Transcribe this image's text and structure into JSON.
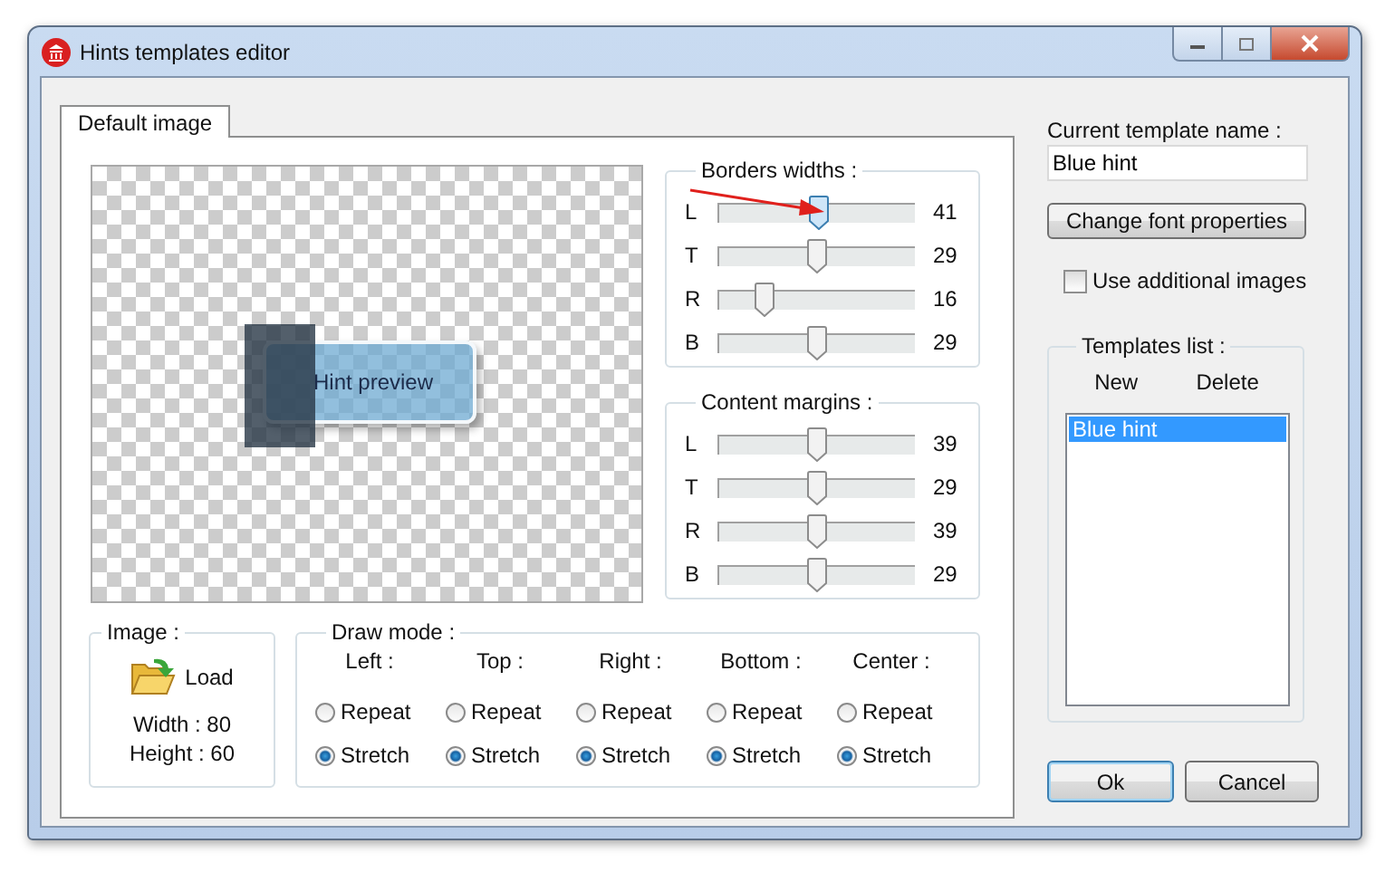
{
  "window": {
    "title": "Hints templates editor"
  },
  "tabs": [
    {
      "label": "Default image",
      "selected": true
    }
  ],
  "preview": {
    "text": "Hint preview"
  },
  "borders_widths": {
    "title": "Borders widths :",
    "sliders": [
      {
        "label": "L",
        "level": 0.51,
        "reading": "41",
        "focused": true
      },
      {
        "label": "T",
        "level": 0.5,
        "reading": "29",
        "focused": false
      },
      {
        "label": "R",
        "level": 0.23,
        "reading": "16",
        "focused": false
      },
      {
        "label": "B",
        "level": 0.5,
        "reading": "29",
        "focused": false
      }
    ]
  },
  "content_margins": {
    "title": "Content margins :",
    "sliders": [
      {
        "label": "L",
        "level": 0.5,
        "reading": "39",
        "focused": false
      },
      {
        "label": "T",
        "level": 0.5,
        "reading": "29",
        "focused": false
      },
      {
        "label": "R",
        "level": 0.5,
        "reading": "39",
        "focused": false
      },
      {
        "label": "B",
        "level": 0.5,
        "reading": "29",
        "focused": false
      }
    ]
  },
  "image": {
    "title": "Image :",
    "load_button": "Load",
    "width": "Width :  80",
    "height": "Height :  60"
  },
  "draw_mode": {
    "title": "Draw mode :",
    "columns": [
      {
        "label": "Left :",
        "options": [
          {
            "label": "Repeat",
            "selected": false
          },
          {
            "label": "Stretch",
            "selected": true
          }
        ]
      },
      {
        "label": "Top :",
        "options": [
          {
            "label": "Repeat",
            "selected": false
          },
          {
            "label": "Stretch",
            "selected": true
          }
        ]
      },
      {
        "label": "Right :",
        "options": [
          {
            "label": "Repeat",
            "selected": false
          },
          {
            "label": "Stretch",
            "selected": true
          }
        ]
      },
      {
        "label": "Bottom :",
        "options": [
          {
            "label": "Repeat",
            "selected": false
          },
          {
            "label": "Stretch",
            "selected": true
          }
        ]
      },
      {
        "label": "Center :",
        "options": [
          {
            "label": "Repeat",
            "selected": false
          },
          {
            "label": "Stretch",
            "selected": true
          }
        ]
      }
    ]
  },
  "current_template": {
    "label": "Current template name :",
    "value": "Blue hint"
  },
  "font_button": "Change font properties",
  "additional_images": {
    "label": "Use additional images",
    "checked": false
  },
  "templates_list": {
    "title": "Templates list :",
    "new": "New",
    "delete": "Delete",
    "items": [
      {
        "label": "Blue hint",
        "selected": true
      }
    ]
  },
  "buttons": [
    {
      "label": "Ok",
      "default": true
    },
    {
      "label": "Cancel",
      "default": false
    }
  ]
}
